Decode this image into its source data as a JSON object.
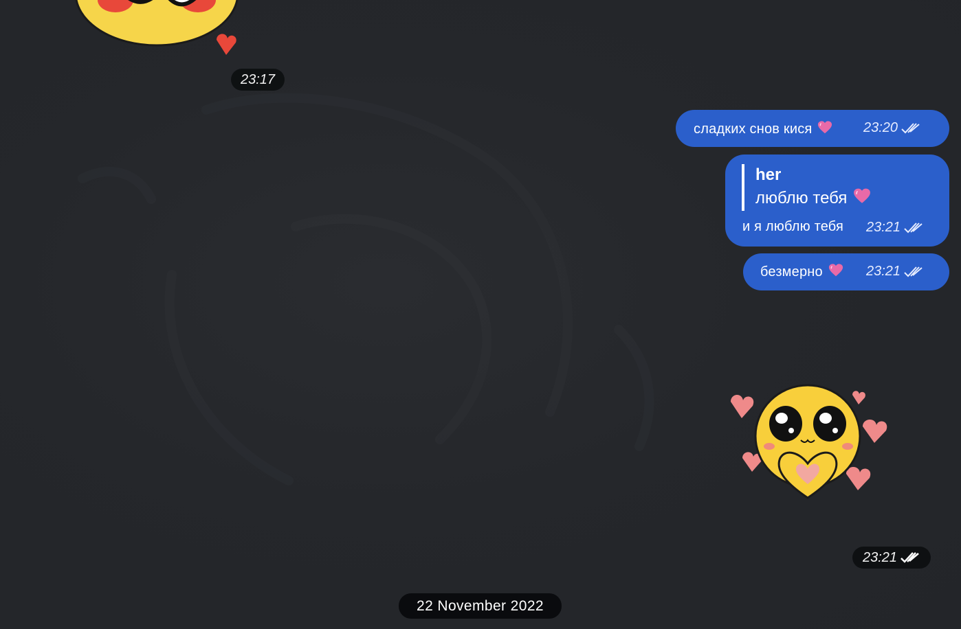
{
  "messages": {
    "sticker_top_time": "23:17",
    "msg1": {
      "text": "сладких снов кися",
      "time": "23:20"
    },
    "msg2": {
      "reply_author": "her",
      "reply_text": "люблю тебя",
      "text": "и я люблю тебя",
      "time": "23:21"
    },
    "msg3": {
      "text": "безмерно",
      "time": "23:21"
    },
    "sticker_bottom_time": "23:21"
  },
  "date_separator": "22 November 2022",
  "colors": {
    "background": "#24262a",
    "outgoing_bubble": "#2b5fcb",
    "time_pill": "#0a0c0e",
    "heart": "#e86aa8"
  },
  "icons": {
    "read_receipt": "double-check-icon",
    "heart_emoji": "heart-emoji-icon",
    "sticker_top": "blushing-emoji-sticker",
    "sticker_bottom": "heart-hands-emoji-sticker"
  }
}
